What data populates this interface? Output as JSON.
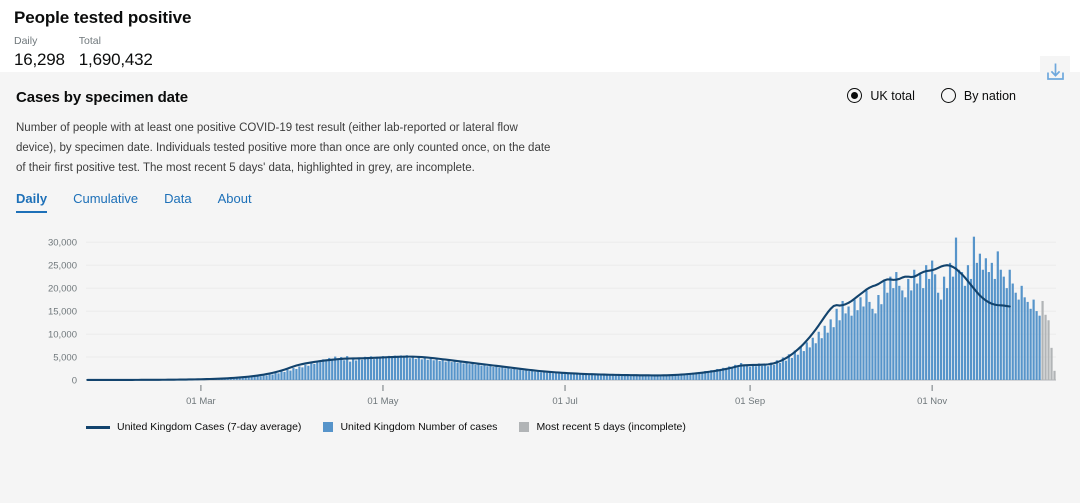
{
  "summary": {
    "title": "People tested positive",
    "metrics": [
      {
        "label": "Daily",
        "value": "16,298"
      },
      {
        "label": "Total",
        "value": "1,690,432"
      }
    ]
  },
  "card": {
    "title": "Cases by specimen date",
    "description": "Number of people with at least one positive COVID-19 test result (either lab-reported or lateral flow device), by specimen date. Individuals tested positive more than once are only counted once, on the date of their first positive test. The most recent 5 days' data, highlighted in grey, are incomplete.",
    "scope_options": [
      {
        "label": "UK total",
        "selected": true
      },
      {
        "label": "By nation",
        "selected": false
      }
    ],
    "download_icon": "download-icon",
    "tabs": [
      {
        "label": "Daily",
        "active": true
      },
      {
        "label": "Cumulative",
        "active": false
      },
      {
        "label": "Data",
        "active": false
      },
      {
        "label": "About",
        "active": false
      }
    ]
  },
  "colors": {
    "bar": "#5694ca",
    "bar_incomplete": "#b1b4b6",
    "line": "#12436d",
    "tab_link": "#1d70b8",
    "card_bg": "#f5f5f5",
    "grid": "#ebebeb"
  },
  "chart_data": {
    "type": "bar",
    "title": "Cases by specimen date",
    "xlabel": "",
    "ylabel": "",
    "ylim": [
      0,
      32000
    ],
    "yticks": [
      0,
      5000,
      10000,
      15000,
      20000,
      25000,
      30000
    ],
    "ytick_labels": [
      "0",
      "5,000",
      "10,000",
      "15,000",
      "20,000",
      "25,000",
      "30,000"
    ],
    "grid": true,
    "legend_position": "bottom",
    "xticks": [
      {
        "label": "01 Mar",
        "index": 38
      },
      {
        "label": "01 May",
        "index": 99
      },
      {
        "label": "01 Jul",
        "index": 160
      },
      {
        "label": "01 Sep",
        "index": 222
      },
      {
        "label": "01 Nov",
        "index": 283
      }
    ],
    "series": [
      {
        "name": "United Kingdom Number of cases",
        "type": "bar",
        "color": "#5694ca",
        "values": [
          10,
          12,
          8,
          14,
          10,
          16,
          12,
          18,
          14,
          20,
          16,
          22,
          18,
          26,
          20,
          30,
          24,
          34,
          28,
          40,
          32,
          46,
          36,
          52,
          44,
          60,
          50,
          70,
          58,
          80,
          66,
          92,
          78,
          110,
          90,
          130,
          105,
          150,
          120,
          180,
          150,
          210,
          175,
          250,
          210,
          300,
          260,
          360,
          310,
          430,
          380,
          520,
          460,
          620,
          560,
          760,
          680,
          900,
          820,
          1100,
          980,
          1350,
          1200,
          1600,
          1450,
          1900,
          1750,
          2250,
          2050,
          2600,
          2400,
          2950,
          2750,
          3300,
          3100,
          3700,
          3500,
          4100,
          3900,
          4500,
          4300,
          4800,
          4600,
          5100,
          4500,
          5000,
          4300,
          5200,
          4000,
          4600,
          4250,
          4900,
          4400,
          5050,
          4600,
          5150,
          4550,
          5050,
          4700,
          5200,
          4800,
          5250,
          4850,
          5300,
          4900,
          5350,
          4950,
          5400,
          4750,
          5200,
          4600,
          5100,
          4500,
          5000,
          4400,
          4900,
          4300,
          4800,
          4150,
          4650,
          4000,
          4500,
          3900,
          4350,
          3750,
          4200,
          3600,
          4050,
          3450,
          3900,
          3300,
          3700,
          3150,
          3550,
          3000,
          3400,
          2850,
          3200,
          2700,
          3050,
          2550,
          2900,
          2400,
          2700,
          2250,
          2550,
          2100,
          2400,
          1950,
          2250,
          1800,
          2100,
          1700,
          1950,
          1600,
          1850,
          1500,
          1750,
          1400,
          1650,
          1300,
          1550,
          1250,
          1450,
          1200,
          1400,
          1150,
          1350,
          1100,
          1300,
          1050,
          1250,
          1000,
          1200,
          980,
          1150,
          950,
          1120,
          920,
          1100,
          900,
          1080,
          880,
          1060,
          870,
          1050,
          860,
          1040,
          850,
          1030,
          870,
          1060,
          900,
          1100,
          950,
          1180,
          1000,
          1250,
          1080,
          1350,
          1150,
          1450,
          1250,
          1600,
          1380,
          1750,
          1500,
          1950,
          1650,
          2150,
          1800,
          2400,
          2000,
          2650,
          2250,
          2950,
          2500,
          3300,
          2800,
          3700,
          3100,
          3200,
          2900,
          3450,
          3000,
          3600,
          3100,
          3500,
          3000,
          3800,
          3300,
          4300,
          3700,
          4900,
          4200,
          5600,
          4800,
          6400,
          5500,
          7200,
          6300,
          8200,
          7100,
          9200,
          8000,
          10500,
          9100,
          11800,
          10300,
          13200,
          11500,
          15500,
          13000,
          17200,
          14500,
          16000,
          14000,
          17500,
          15200,
          18000,
          16000,
          19500,
          17000,
          15500,
          14500,
          18500,
          16500,
          21500,
          19000,
          22500,
          20000,
          23500,
          20500,
          19500,
          18000,
          22000,
          19500,
          24000,
          21000,
          23000,
          20000,
          25000,
          22000,
          26000,
          23000,
          19000,
          17500,
          22500,
          20000,
          25500,
          22500,
          31000,
          24000,
          23500,
          20500,
          25000,
          22000,
          31200,
          25500,
          27500,
          24000,
          26500,
          23500,
          25500,
          22000,
          28000,
          24000,
          22500,
          20000,
          24000,
          21000,
          19000,
          17500,
          20500,
          18000,
          17000,
          15500,
          17500,
          15000,
          14000
        ]
      },
      {
        "name": "Most recent 5 days (incomplete)",
        "type": "bar",
        "color": "#b1b4b6",
        "values": [
          17200,
          14200,
          13000,
          7000,
          2000
        ]
      },
      {
        "name": "United Kingdom Cases (7-day average)",
        "type": "line",
        "color": "#12436d",
        "values": [
          12,
          12,
          13,
          13,
          14,
          15,
          15,
          16,
          17,
          18,
          19,
          20,
          21,
          22,
          24,
          25,
          27,
          29,
          31,
          33,
          36,
          38,
          41,
          45,
          48,
          52,
          57,
          62,
          67,
          73,
          80,
          87,
          95,
          104,
          114,
          125,
          137,
          150,
          165,
          181,
          199,
          218,
          240,
          263,
          289,
          317,
          348,
          382,
          420,
          461,
          506,
          556,
          610,
          670,
          736,
          808,
          887,
          974,
          1070,
          1175,
          1290,
          1417,
          1556,
          1709,
          1877,
          2061,
          2263,
          2485,
          2729,
          2950,
          3150,
          3320,
          3470,
          3600,
          3720,
          3830,
          3930,
          4030,
          4120,
          4200,
          4280,
          4350,
          4420,
          4480,
          4540,
          4590,
          4630,
          4660,
          4680,
          4690,
          4700,
          4710,
          4720,
          4740,
          4770,
          4800,
          4830,
          4860,
          4890,
          4920,
          4950,
          4980,
          5000,
          5020,
          5040,
          5060,
          5080,
          5090,
          5090,
          5080,
          5060,
          5030,
          4990,
          4940,
          4880,
          4820,
          4750,
          4680,
          4600,
          4520,
          4440,
          4360,
          4280,
          4200,
          4120,
          4040,
          3960,
          3880,
          3800,
          3720,
          3640,
          3560,
          3480,
          3400,
          3320,
          3240,
          3160,
          3080,
          3000,
          2920,
          2840,
          2760,
          2680,
          2600,
          2520,
          2440,
          2360,
          2280,
          2200,
          2130,
          2060,
          1990,
          1930,
          1870,
          1810,
          1760,
          1710,
          1660,
          1610,
          1570,
          1530,
          1490,
          1450,
          1420,
          1390,
          1360,
          1330,
          1300,
          1280,
          1260,
          1240,
          1220,
          1200,
          1180,
          1160,
          1145,
          1130,
          1115,
          1100,
          1090,
          1080,
          1070,
          1060,
          1050,
          1040,
          1030,
          1020,
          1015,
          1010,
          1005,
          1000,
          1000,
          1005,
          1015,
          1030,
          1050,
          1075,
          1105,
          1140,
          1180,
          1225,
          1275,
          1330,
          1390,
          1455,
          1525,
          1600,
          1680,
          1765,
          1855,
          1950,
          2055,
          2165,
          2285,
          2415,
          2555,
          2700,
          2860,
          3020,
          3150,
          3200,
          3230,
          3250,
          3270,
          3290,
          3310,
          3330,
          3350,
          3400,
          3500,
          3650,
          3850,
          4100,
          4400,
          4750,
          5150,
          5600,
          6100,
          6650,
          7250,
          7900,
          8600,
          9350,
          10150,
          11000,
          11900,
          12850,
          13800,
          14700,
          15500,
          16100,
          16300,
          16200,
          16300,
          16500,
          16800,
          17200,
          17700,
          18200,
          18700,
          19200,
          19700,
          20100,
          20400,
          20600,
          20900,
          21300,
          21700,
          21900,
          21900,
          21800,
          21850,
          22000,
          22300,
          22500,
          22500,
          22400,
          22500,
          22800,
          23200,
          23500,
          23700,
          23800,
          23900,
          24100,
          24400,
          24700,
          24900,
          25000,
          24900,
          24600,
          24200,
          23600,
          23000,
          22300,
          21500,
          20700,
          19900,
          19100,
          18400,
          17800,
          17300,
          16900,
          16600,
          16400,
          16300,
          16250,
          16200,
          16100,
          16000
        ]
      }
    ],
    "legend": [
      {
        "label": "United Kingdom Cases (7-day average)",
        "marker": "line",
        "color": "#12436d"
      },
      {
        "label": "United Kingdom Number of cases",
        "marker": "square",
        "color": "#5694ca"
      },
      {
        "label": "Most recent 5 days (incomplete)",
        "marker": "square",
        "color": "#b1b4b6"
      }
    ]
  }
}
